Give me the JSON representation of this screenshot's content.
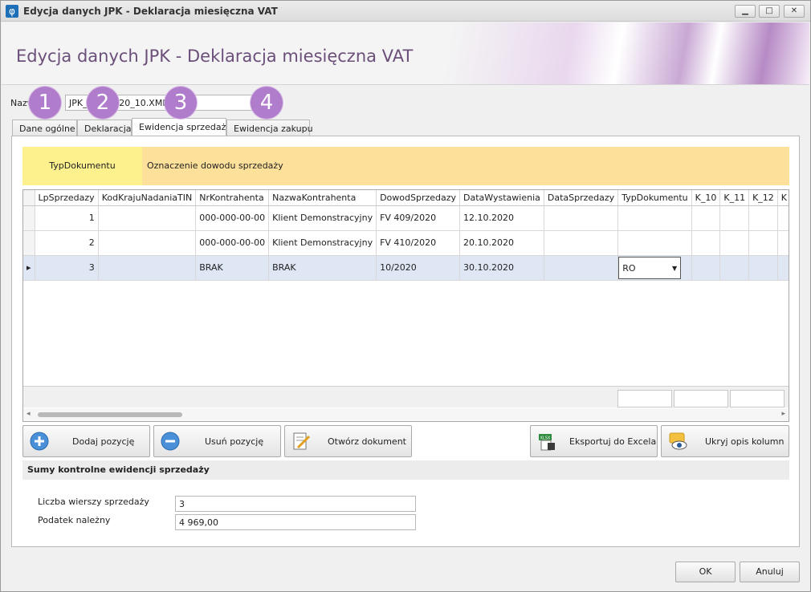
{
  "window": {
    "title": "Edycja danych JPK - Deklaracja miesięczna VAT",
    "app_icon_glyph": "φ",
    "controls": [
      "minimize-icon",
      "maximize-icon",
      "close-icon"
    ]
  },
  "header": {
    "title": "Edycja danych JPK - Deklaracja miesięczna VAT"
  },
  "name_field": {
    "label": "Nazwa",
    "value": "JPK_VAT_2020_10.XML"
  },
  "steps": [
    "1",
    "2",
    "3",
    "4"
  ],
  "tabs": [
    {
      "label": "Dane ogólne",
      "active": false
    },
    {
      "label": "Deklaracja",
      "active": false
    },
    {
      "label": "Ewidencja sprzedaży",
      "active": true
    },
    {
      "label": "Ewidencja zakupu",
      "active": false
    }
  ],
  "description_band": {
    "column": "TypDokumentu",
    "description": "Oznaczenie dowodu sprzedaży",
    "colors": {
      "column_bg": "#fdf18e",
      "description_bg": "#fde09a"
    }
  },
  "grid": {
    "columns": [
      "LpSprzedazy",
      "KodKrajuNadaniaTIN",
      "NrKontrahenta",
      "NazwaKontrahenta",
      "DowodSprzedazy",
      "DataWystawienia",
      "DataSprzedazy",
      "TypDokumentu",
      "K_10",
      "K_11",
      "K_12",
      "K"
    ],
    "rows": [
      {
        "lp": "1",
        "kod": "",
        "nr": "000-000-00-00",
        "nazwa": "Klient Demonstracyjny",
        "dowod": "FV 409/2020",
        "data_wyst": "12.10.2020",
        "data_sprz": "",
        "typ": "",
        "k10": "",
        "k11": "",
        "k12": "",
        "selected": false
      },
      {
        "lp": "2",
        "kod": "",
        "nr": "000-000-00-00",
        "nazwa": "Klient Demonstracyjny",
        "dowod": "FV 410/2020",
        "data_wyst": "20.10.2020",
        "data_sprz": "",
        "typ": "",
        "k10": "",
        "k11": "",
        "k12": "",
        "selected": false
      },
      {
        "lp": "3",
        "kod": "",
        "nr": "BRAK",
        "nazwa": "BRAK",
        "dowod": "10/2020",
        "data_wyst": "30.10.2020",
        "data_sprz": "",
        "typ": "RO",
        "k10": "",
        "k11": "",
        "k12": "",
        "selected": true
      }
    ],
    "selected_row_indicator": "▸",
    "dropdown_arrow": "▼"
  },
  "buttons": {
    "add": "Dodaj pozycję",
    "remove": "Usuń pozycję",
    "open": "Otwórz dokument",
    "export": "Eksportuj do Excela",
    "hide": "Ukryj opis kolumn",
    "export_icon_text": "XLSX"
  },
  "sums": {
    "title": "Sumy kontrolne ewidencji sprzedaży",
    "rows_label": "Liczba wierszy sprzedaży",
    "rows_value": "3",
    "tax_label": "Podatek należny",
    "tax_value": "4 969,00"
  },
  "footer": {
    "ok": "OK",
    "cancel": "Anuluj"
  }
}
